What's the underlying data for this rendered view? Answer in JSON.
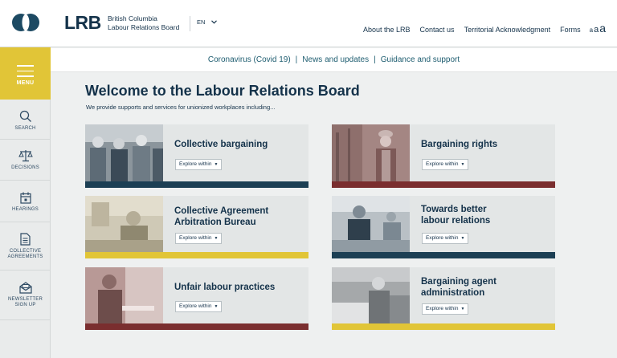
{
  "header": {
    "brand": "LRB",
    "brand_sub_line1": "British Columbia",
    "brand_sub_line2": "Labour Relations Board",
    "lang": "EN",
    "nav": [
      "About the LRB",
      "Contact us",
      "Territorial Acknowledgment",
      "Forms"
    ],
    "font_sizes": [
      "a",
      "a",
      "a"
    ]
  },
  "sidebar": {
    "menu_label": "MENU",
    "items": [
      {
        "label": "SEARCH",
        "icon": "search-icon"
      },
      {
        "label": "DECISIONS",
        "icon": "scales-icon"
      },
      {
        "label": "HEARINGS",
        "icon": "calendar-icon"
      },
      {
        "label_line1": "COLLECTIVE",
        "label_line2": "AGREEMENTS",
        "icon": "document-icon"
      },
      {
        "label_line1": "NEWSLETTER",
        "label_line2": "SIGN UP",
        "icon": "envelope-icon"
      }
    ]
  },
  "subnav": {
    "items": [
      "Coronavirus (Covid 19)",
      "News and updates",
      "Guidance and support"
    ],
    "separator": "|"
  },
  "main": {
    "title": "Welcome to the Labour Relations Board",
    "intro": "We provide supports and services for unionized workplaces including..."
  },
  "cards": [
    {
      "title_line1": "Collective bargaining",
      "title_line2": "",
      "button": "Explore within",
      "accent": "#1c3f54"
    },
    {
      "title_line1": "Bargaining rights",
      "title_line2": "",
      "button": "Explore within",
      "accent": "#7a2e2f"
    },
    {
      "title_line1": "Collective Agreement",
      "title_line2": "Arbitration Bureau",
      "button": "Explore within",
      "accent": "#e1c537"
    },
    {
      "title_line1": "Towards better",
      "title_line2": "labour relations",
      "button": "Explore within",
      "accent": "#1c3f54"
    },
    {
      "title_line1": "Unfair labour practices",
      "title_line2": "",
      "button": "Explore within",
      "accent": "#7a2e2f"
    },
    {
      "title_line1": "Bargaining agent",
      "title_line2": "administration",
      "button": "Explore within",
      "accent": "#e1c537"
    }
  ],
  "colors": {
    "navy": "#14324a",
    "yellow": "#e1c537",
    "maroon": "#7a2e2f",
    "teal_link": "#1e5d70"
  }
}
